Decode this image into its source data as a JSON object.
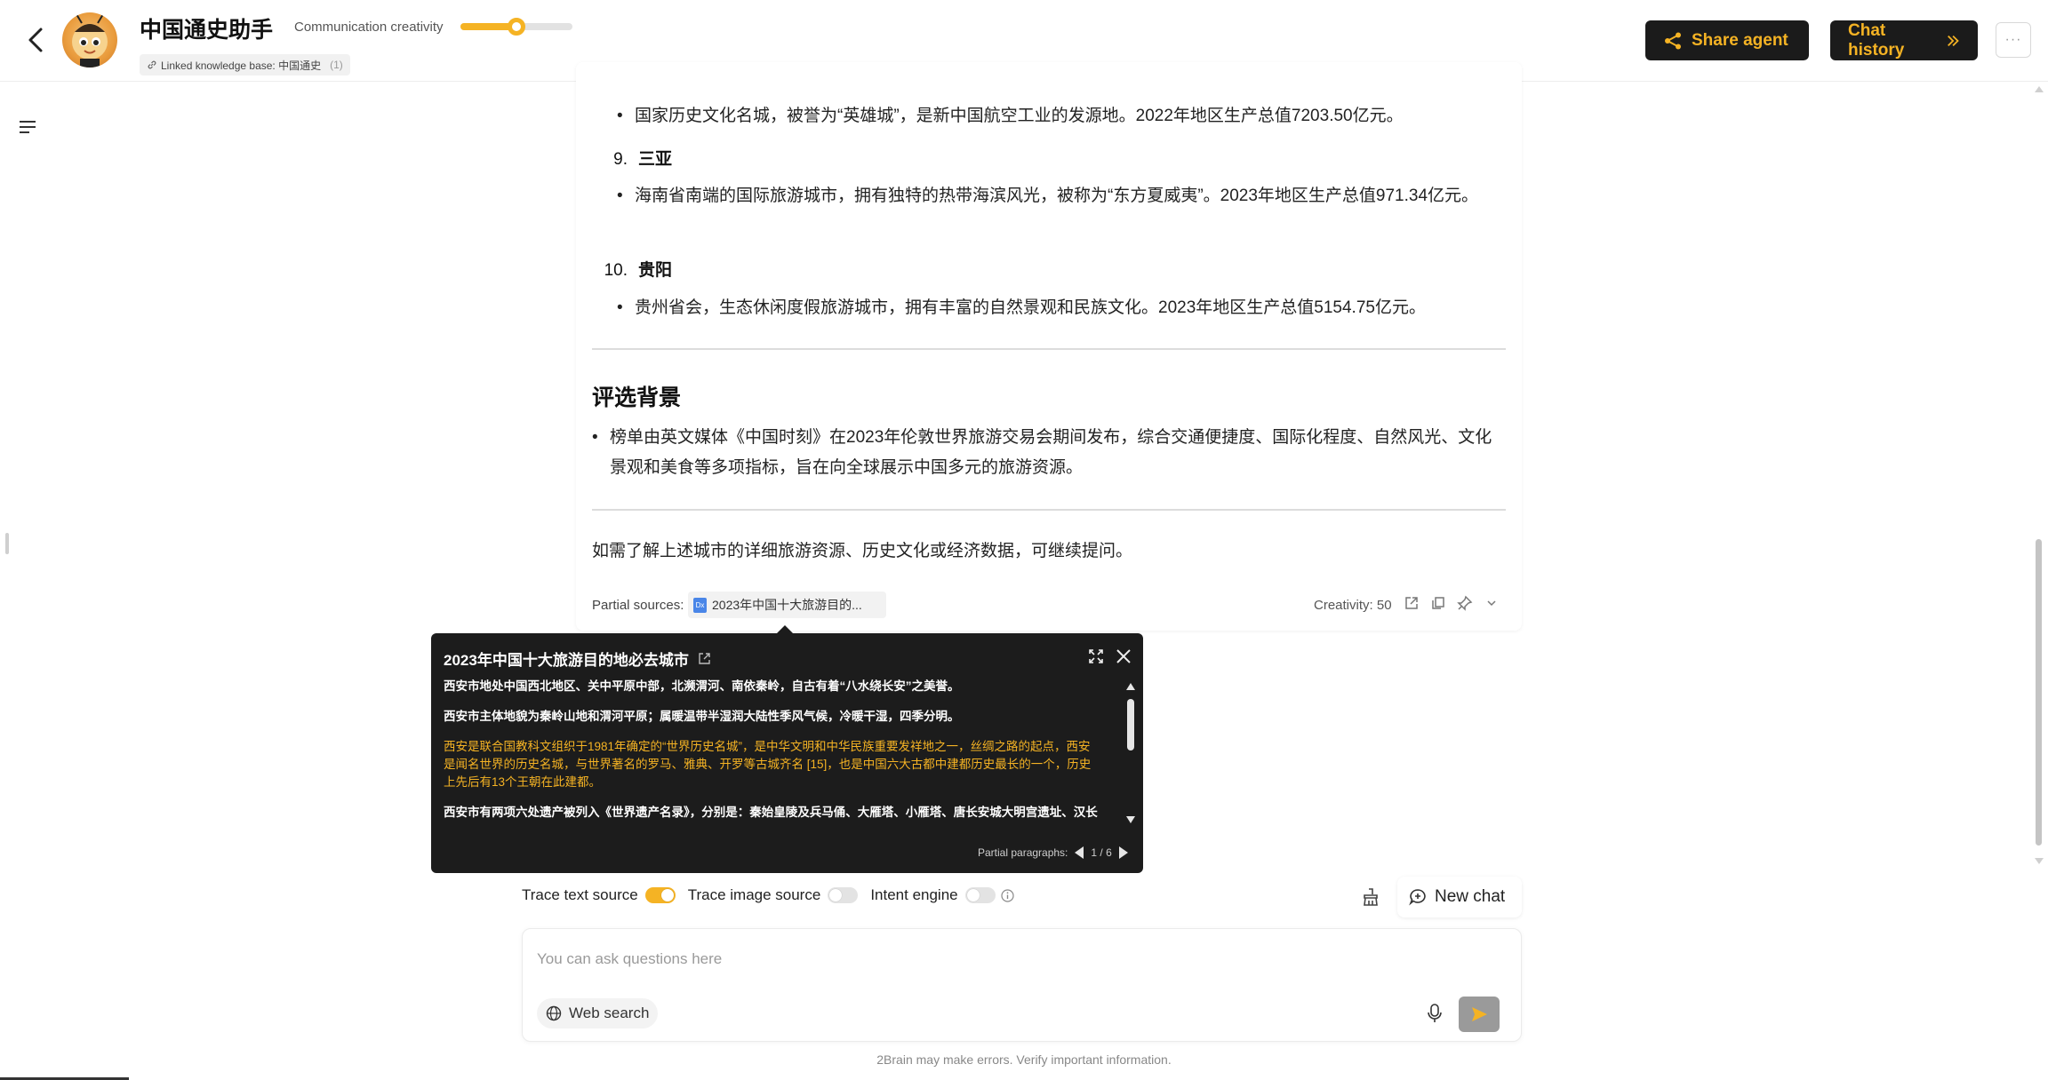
{
  "header": {
    "agent_name": "中国通史助手",
    "creativity_label": "Communication creativity",
    "creativity_level": 0.5,
    "knowledge_base_label": "Linked knowledge base: 中国通史",
    "knowledge_base_count": "(1)",
    "share_label": "Share agent",
    "history_label": "Chat history",
    "more_label": "···"
  },
  "answer": {
    "item8_text": "国家历史文化名城，被誉为“英雄城”，是新中国航空工业的发源地。2022年地区生产总值7203.50亿元。",
    "item9_number": "9.",
    "item9_title": "三亚",
    "item9_text": "海南省南端的国际旅游城市，拥有独特的热带海滨风光，被称为“东方夏威夷”。2023年地区生产总值971.34亿元。",
    "item10_number": "10.",
    "item10_title": "贵阳",
    "item10_text": "贵州省会，生态休闲度假旅游城市，拥有丰富的自然景观和民族文化。2023年地区生产总值5154.75亿元。",
    "section_title": "评选背景",
    "section_text": "榜单由英文媒体《中国时刻》在2023年伦敦世界旅游交易会期间发布，综合交通便捷度、国际化程度、自然风光、文化景观和美食等多项指标，旨在向全球展示中国多元的旅游资源。",
    "closing": "如需了解上述城市的详细旅游资源、历史文化或经济数据，可继续提问。",
    "sources_label": "Partial sources:",
    "source_doc": "2023年中国十大旅游目的...",
    "doc_badge": "Dx",
    "creativity_value": "Creativity: 50"
  },
  "popup": {
    "title": "2023年中国十大旅游目的地必去城市",
    "paragraphs": [
      "西安市地处中国西北地区、关中平原中部，北濒渭河、南依秦岭，自古有着“八水绕长安”之美誉。",
      "西安市主体地貌为秦岭山地和渭河平原；属暖温带半湿润大陆性季风气候，冷暖干湿，四季分明。",
      "西安是联合国教科文组织于1981年确定的“世界历史名城”，是中华文明和中华民族重要发祥地之一，丝绸之路的起点，西安是闻名世界的历史名城，与世界著名的罗马、雅典、开罗等古城齐名 [15]，也是中国六大古都中建都历史最长的一个，历史上先后有13个王朝在此建都。",
      "西安市有两项六处遗产被列入《世界遗产名录》，分别是：秦始皇陵及兵马俑、大雁塔、小雁塔、唐长安城大明宫遗址、汉长安城未央宫遗址、兴教寺塔。"
    ],
    "pager_label": "Partial paragraphs:",
    "pager_value": "1 / 6"
  },
  "controls": {
    "trace_text_label": "Trace text source",
    "trace_image_label": "Trace image source",
    "intent_label": "Intent engine",
    "new_chat_label": "New chat"
  },
  "input": {
    "placeholder": "You can ask questions here",
    "web_search_label": "Web search"
  },
  "disclaimer": "2Brain may make errors. Verify important information.",
  "colors": {
    "accent": "#f5b324",
    "dark": "#1b1b1b"
  }
}
